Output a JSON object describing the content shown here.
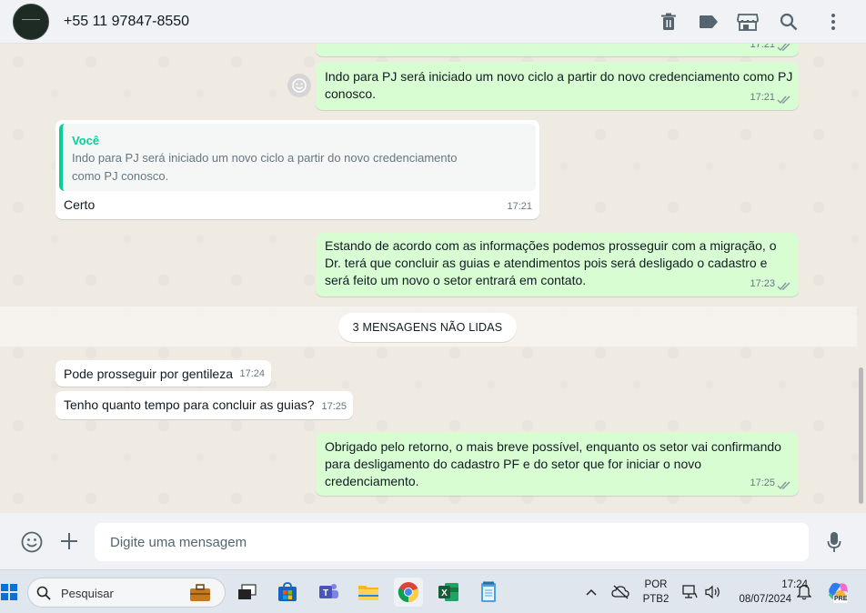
{
  "header": {
    "contact_name": "+55 11 97847-8550",
    "icons": [
      "trash-icon",
      "label-icon",
      "store-icon",
      "search-icon",
      "menu-dots-icon"
    ]
  },
  "messages": [
    {
      "direction": "out",
      "text": "Indo para PJ será iniciado um novo ciclo a partir do novo credenciamento como PJ conosco.",
      "time": "17:21",
      "status": "read"
    },
    {
      "direction": "in",
      "quoted_author": "Você",
      "quoted_text": "Indo para PJ será iniciado um novo ciclo a partir do novo credenciamento como PJ conosco.",
      "text": "Certo",
      "time": "17:21"
    },
    {
      "direction": "out",
      "text": "Estando de acordo com as informações podemos prosseguir com a migração, o Dr. terá que concluir as guias e atendimentos pois será desligado o cadastro e será feito um novo o setor entrará em contato.",
      "time": "17:23",
      "status": "read"
    },
    {
      "direction": "in",
      "text": "Pode prosseguir por gentileza",
      "time": "17:24"
    },
    {
      "direction": "in",
      "text": "Tenho quanto tempo para concluir as guias?",
      "time": "17:25"
    },
    {
      "direction": "out",
      "text": "Obrigado pelo retorno, o mais breve possível, enquanto os setor vai confirmando para desligamento do cadastro PF e do setor que for iniciar o novo credenciamento.",
      "time": "17:25",
      "status": "read"
    }
  ],
  "top_partial_time": "17:21",
  "unread_banner": "3 MENSAGENS NÃO LIDAS",
  "composer": {
    "placeholder": "Digite uma mensagem"
  },
  "taskbar": {
    "search_placeholder": "Pesquisar",
    "language_top": "POR",
    "language_bottom": "PTB2",
    "clock_time": "17:24",
    "clock_date": "08/07/2024",
    "copilot_badge": "PRE"
  },
  "colors": {
    "outgoing_bubble": "#d9fdd3",
    "incoming_bubble": "#ffffff",
    "accent": "#06cf9c",
    "read_ticks": "#8696a0"
  }
}
